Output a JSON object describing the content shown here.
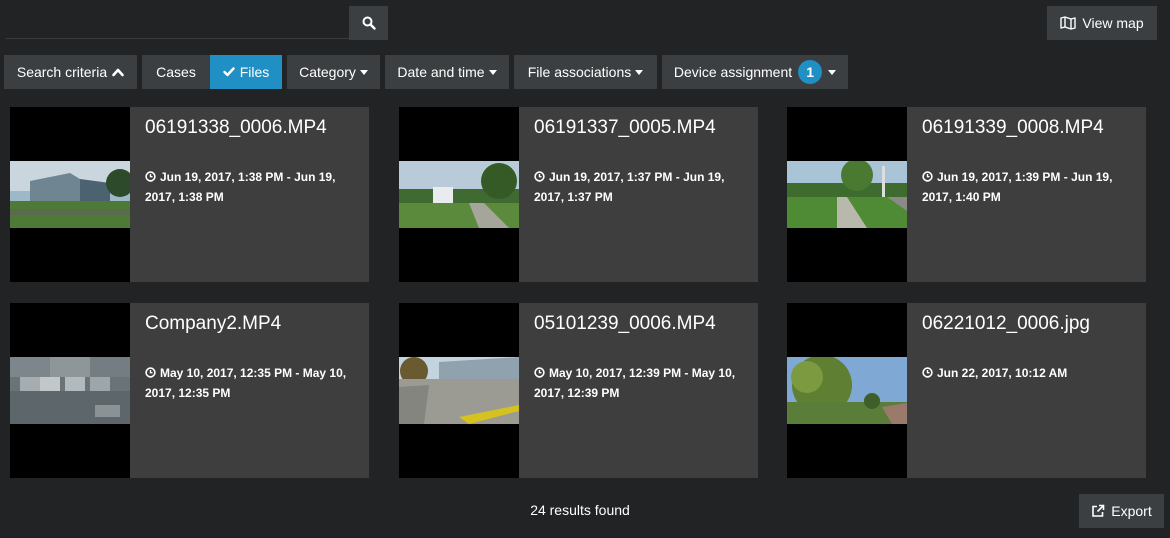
{
  "search": {
    "placeholder": "",
    "value": ""
  },
  "toolbar": {
    "view_map_label": "View map",
    "export_label": "Export"
  },
  "filters": {
    "search_criteria": "Search criteria",
    "cases": "Cases",
    "files": "Files",
    "category": "Category",
    "date_time": "Date and time",
    "file_associations": "File associations",
    "device_assignment": "Device assignment",
    "device_assignment_count": "1"
  },
  "files": [
    {
      "name": "06191338_0006.MP4",
      "date": "Jun 19, 2017, 1:38 PM - Jun 19, 2017, 1:38 PM",
      "thumb": "building-campus"
    },
    {
      "name": "06191337_0005.MP4",
      "date": "Jun 19, 2017, 1:37 PM - Jun 19, 2017, 1:37 PM",
      "thumb": "path-sign"
    },
    {
      "name": "06191339_0008.MP4",
      "date": "Jun 19, 2017, 1:39 PM - Jun 19, 2017, 1:40 PM",
      "thumb": "sidewalk-trees"
    },
    {
      "name": "Company2.MP4",
      "date": "May 10, 2017, 12:35 PM - May 10, 2017, 12:35 PM",
      "thumb": "pixelated"
    },
    {
      "name": "05101239_0006.MP4",
      "date": "May 10, 2017, 12:39 PM - May 10, 2017, 12:39 PM",
      "thumb": "parking-curb"
    },
    {
      "name": "06221012_0006.jpg",
      "date": "Jun 22, 2017, 10:12 AM",
      "thumb": "tree-road"
    }
  ],
  "status": {
    "results_text": "24 results found"
  },
  "colors": {
    "background": "#212325",
    "card": "#3e3e3e",
    "button": "#3c3f42",
    "accent": "#1f8fc4"
  }
}
